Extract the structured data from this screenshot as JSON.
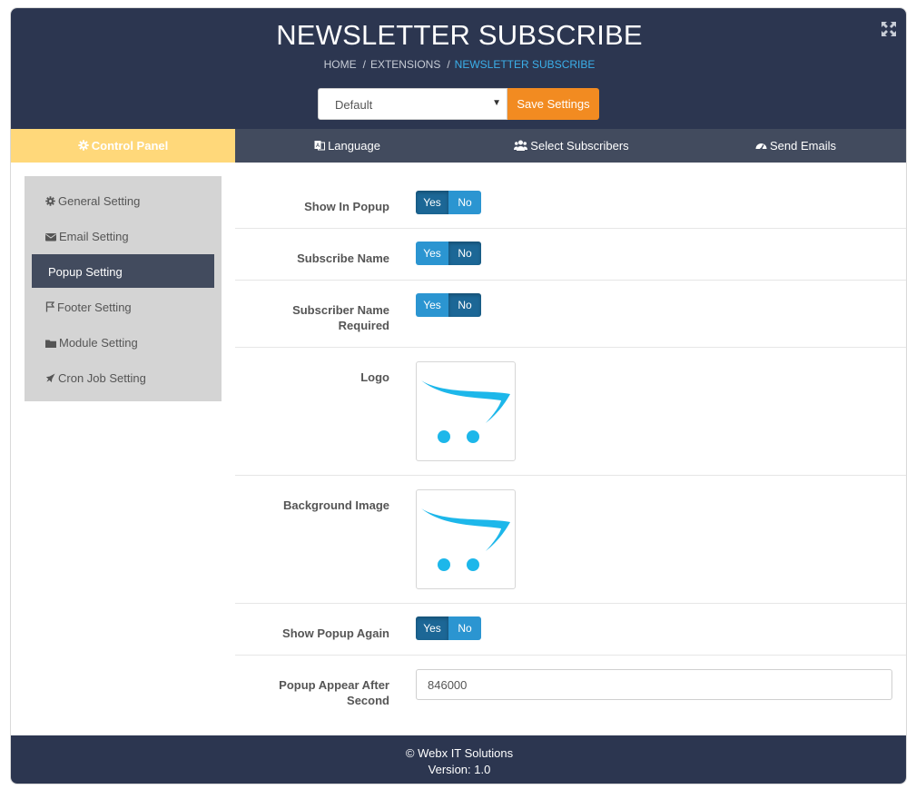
{
  "header": {
    "title": "NEWSLETTER SUBSCRIBE",
    "breadcrumb": [
      "HOME",
      "EXTENSIONS",
      "NEWSLETTER SUBSCRIBE"
    ],
    "breadcrumb_separator": "/",
    "store_select": "Default",
    "save_label": "Save Settings",
    "expand_icon": "expand-arrows-icon"
  },
  "tabs": [
    {
      "label": "Control Panel",
      "icon": "gear-icon"
    },
    {
      "label": "Language",
      "icon": "language-icon"
    },
    {
      "label": "Select Subscribers",
      "icon": "users-icon"
    },
    {
      "label": "Send Emails",
      "icon": "dashboard-icon"
    }
  ],
  "sidebar": {
    "items": [
      {
        "label": "General Setting",
        "icon": "gear-icon"
      },
      {
        "label": "Email Setting",
        "icon": "envelope-icon"
      },
      {
        "label": "Popup Setting",
        "icon": ""
      },
      {
        "label": "Footer Setting",
        "icon": "flag-icon"
      },
      {
        "label": "Module Setting",
        "icon": "folder-icon"
      },
      {
        "label": "Cron Job Setting",
        "icon": "rocket-icon"
      }
    ],
    "active": "Popup Setting"
  },
  "form": {
    "show_in_popup": {
      "label": "Show In Popup",
      "yes": "Yes",
      "no": "No",
      "selected": "Yes"
    },
    "subscribe_name": {
      "label": "Subscribe Name",
      "yes": "Yes",
      "no": "No",
      "selected": "No"
    },
    "subscriber_name_required": {
      "label_line1": "Subscriber Name",
      "label_line2": "Required",
      "yes": "Yes",
      "no": "No",
      "selected": "No"
    },
    "logo": {
      "label": "Logo"
    },
    "background_image": {
      "label": "Background Image"
    },
    "show_popup_again": {
      "label": "Show Popup Again",
      "yes": "Yes",
      "no": "No",
      "selected": "Yes"
    },
    "popup_appear_after": {
      "label_line1": "Popup Appear After",
      "label_line2": "Second",
      "value": "846000"
    }
  },
  "footer": {
    "copyright": "© Webx IT Solutions",
    "version": "Version: 1.0"
  },
  "colors": {
    "header_bg": "#2c3650",
    "tab_bar_bg": "#424b5e",
    "active_tab_bg": "#ffd87a",
    "save_button": "#f28b21",
    "toggle_selected": "#1c6796",
    "toggle_unselected": "#2b95d1",
    "breadcrumb_active": "#3bb0ea",
    "sidebar_bg": "#d4d4d4",
    "cart_logo": "#1db7ea"
  }
}
